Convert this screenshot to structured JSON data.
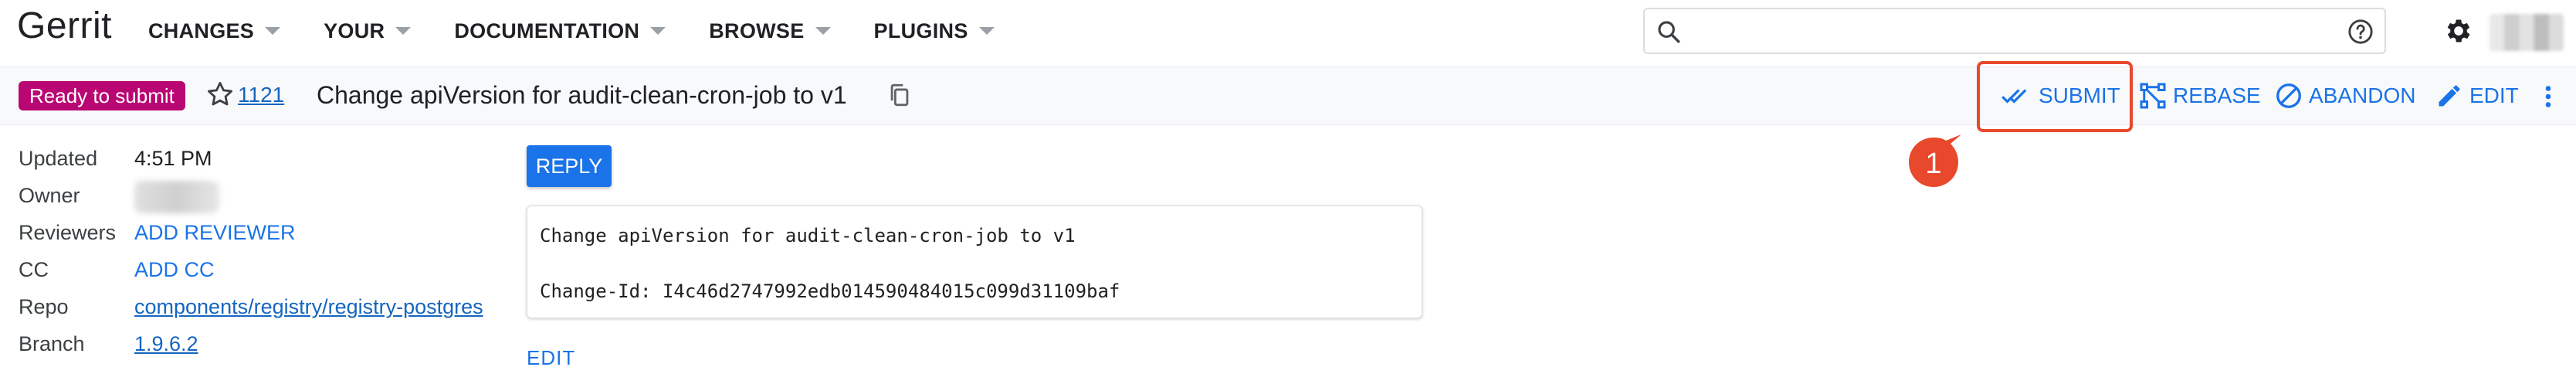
{
  "app": {
    "logo": "Gerrit"
  },
  "nav": {
    "items": [
      {
        "label": "CHANGES"
      },
      {
        "label": "YOUR"
      },
      {
        "label": "DOCUMENTATION"
      },
      {
        "label": "BROWSE"
      },
      {
        "label": "PLUGINS"
      }
    ]
  },
  "search": {
    "value": "",
    "placeholder": ""
  },
  "change": {
    "status": "Ready to submit",
    "number": "1121",
    "title": "Change apiVersion for audit-clean-cron-job to v1"
  },
  "actions": {
    "submit": "SUBMIT",
    "rebase": "REBASE",
    "abandon": "ABANDON",
    "edit": "EDIT"
  },
  "metadata": {
    "updated": {
      "label": "Updated",
      "value": "4:51 PM"
    },
    "owner": {
      "label": "Owner"
    },
    "reviewers": {
      "label": "Reviewers",
      "value": "ADD REVIEWER"
    },
    "cc": {
      "label": "CC",
      "value": "ADD CC"
    },
    "repo": {
      "label": "Repo",
      "value": "components/registry/registry-postgres"
    },
    "branch": {
      "label": "Branch",
      "value": "1.9.6.2"
    }
  },
  "main": {
    "reply_label": "REPLY",
    "commit_message": {
      "line1": "Change apiVersion for audit-clean-cron-job to v1",
      "line2": "Change-Id: I4c46d2747992edb014590484015c099d31109baf"
    },
    "edit_label": "EDIT"
  },
  "callout": {
    "number": "1"
  },
  "colors": {
    "status_badge": "#b80672",
    "accent": "#1a73e8",
    "highlight": "#e8492c"
  }
}
